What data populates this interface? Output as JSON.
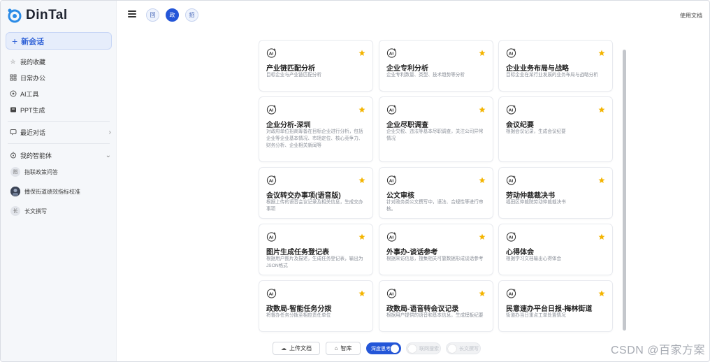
{
  "app": {
    "logo_text": "DinTal"
  },
  "sidebar": {
    "new_chat_label": "新会话",
    "nav": [
      {
        "label": "我的收藏",
        "icon": "star-outline-icon"
      },
      {
        "label": "日常办公",
        "icon": "office-icon"
      },
      {
        "label": "AI工具",
        "icon": "ai-tool-icon"
      },
      {
        "label": "PPT生成",
        "icon": "ppt-icon"
      }
    ],
    "recent_label": "最近对话",
    "agents_label": "我的智能体",
    "agents": [
      {
        "avatar": "指",
        "label": "指联政策问答"
      },
      {
        "avatar": "",
        "label": "播保街道绩效指标校准"
      },
      {
        "avatar": "长",
        "label": "长文撰写"
      }
    ]
  },
  "topbar": {
    "chips": [
      {
        "label": "回",
        "active": false
      },
      {
        "label": "政",
        "active": true
      },
      {
        "label": "招",
        "active": false
      }
    ],
    "doc_link": "使用文档"
  },
  "cards": [
    {
      "title": "产业链匹配分析",
      "desc": "目标企业与产业链匹配分析"
    },
    {
      "title": "企业专利分析",
      "desc": "企业专利数量、类型、技术趋势等分析"
    },
    {
      "title": "企业业务布局与战略",
      "desc": "目标企业在某行业发展的业务布局与战略分析"
    },
    {
      "title": "企业分析-深圳",
      "desc": "对政府单位招商筹备在目标企业进行分析，包括企业等企业基本情况、市场定位、核心竞争力、财务分析、企业相关新闻等"
    },
    {
      "title": "企业尽职调查",
      "desc": "企业欠税、违法等基本尽职调查，关注公司异常情况"
    },
    {
      "title": "会议纪要",
      "desc": "根据会议记录，生成会议纪要"
    },
    {
      "title": "会议转交办事项(语音版)",
      "desc": "根据上传的语音会议记录及相关信息，生成交办事项"
    },
    {
      "title": "公文审核",
      "desc": "针对政务类公文撰写中，语法、合规性等进行审核。"
    },
    {
      "title": "劳动仲裁裁决书",
      "desc": "福田区仲裁院劳动仲裁裁决书"
    },
    {
      "title": "图片生成任务登记表",
      "desc": "根据用户图片及描述，生成任务登记表，输出为JSON格式"
    },
    {
      "title": "外事办-谈话参考",
      "desc": "根据来访信息，搜集相关可靠数据形成谈话参考"
    },
    {
      "title": "心得体会",
      "desc": "根据学习文档输出心得体会"
    },
    {
      "title": "政数局-智能任务分拨",
      "desc": "将督办任务分拨至相应责任单位"
    },
    {
      "title": "政数局-语音转会议记录",
      "desc": "根据用户提供的语音和基本信息，生成模板纪要"
    },
    {
      "title": "民意速办平台日报-梅林街道",
      "desc": "街道办当日重点工单处置情况"
    }
  ],
  "bottom": {
    "upload_label": "上传文档",
    "knowledge_label": "智库",
    "toggles": [
      {
        "label": "深度思考",
        "on": true
      },
      {
        "label": "联网搜索",
        "on": false
      },
      {
        "label": "长文撰写",
        "on": false
      }
    ]
  },
  "watermark": "CSDN @百家方案",
  "colors": {
    "accent": "#2456d8",
    "star": "#f4b400",
    "sidebar_bg": "#f5f7fa"
  }
}
